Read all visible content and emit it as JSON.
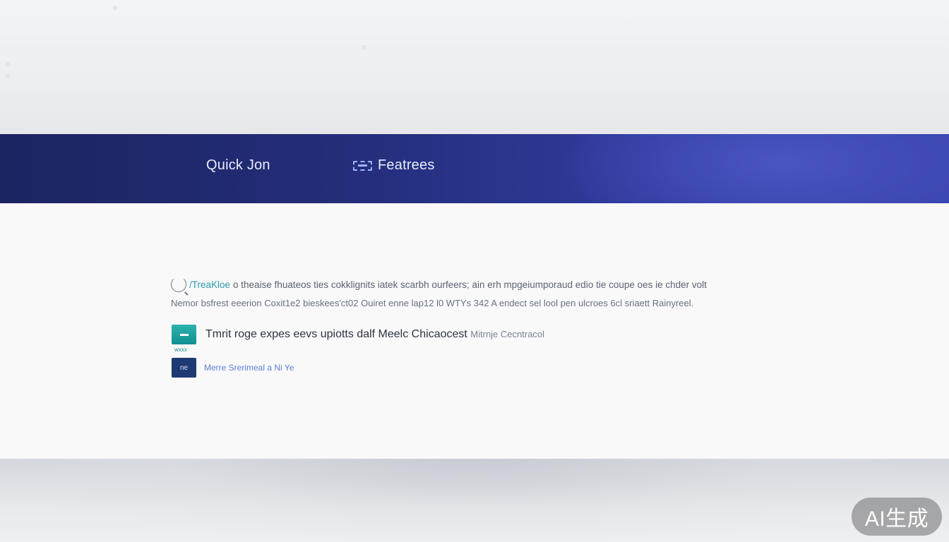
{
  "nav": {
    "quick_label": "Quick Jon",
    "features_label": "Featrees",
    "features_icon": "features-icon"
  },
  "content": {
    "intro_icon": "loading-icon",
    "intro_line1_accent": "/TreaKloe",
    "intro_line1": "o theaise fhuateos ties cokklignits iatek scarbh ourfeers; ain erh mpgeiumporaud edio tie coupe oes ie chder volt",
    "intro_line2": "Nemor bsfrest eeerion Coxit1e2  bieskees'ct02 Ouiret enne lap12 l0 WTYs 342 A endect sel lool  pen ulcroes 6cl sriaett Rainyreel.",
    "row1_badge_caption": "wxxx",
    "row1_text": "Tmrit roge expes eevs upiotts dalf Meelc Chicaocest",
    "row1_sub": "Mitrnje Cecntracol",
    "row2_badge": "ne",
    "row2_text": "Merre  Srerimeal  a  Ni Ye"
  },
  "watermark": "AI生成"
}
